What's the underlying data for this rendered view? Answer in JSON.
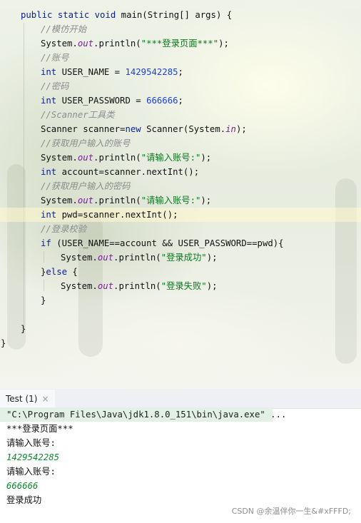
{
  "editor": {
    "signature": {
      "kw1": "public",
      "kw2": "static",
      "kw3": "void",
      "rest": " main(String[] args) {"
    },
    "comment_mock_start": "//模仿开始",
    "print_login_page": {
      "prefix": "System.",
      "field": "out",
      "mid": ".println(",
      "str": "\"***登录页面***\"",
      "suffix": ");"
    },
    "comment_account": "//账号",
    "user_name_decl": {
      "type": "int",
      "name": " USER_NAME = ",
      "value": "1429542285",
      "suffix": ";"
    },
    "comment_password": "//密码",
    "user_password_decl": {
      "type": "int",
      "name": " USER_PASSWORD = ",
      "value": "666666",
      "suffix": ";"
    },
    "comment_scanner": "//Scanner工具类",
    "scanner_decl": {
      "prefix": "Scanner scanner=",
      "kw": "new",
      "mid": " Scanner(System.",
      "field": "in",
      "suffix": ");"
    },
    "comment_get_account": "//获取用户输入的账号",
    "print_prompt_1": {
      "prefix": "System.",
      "field": "out",
      "mid": ".println(",
      "str": "\"请输入账号:\"",
      "suffix": ");"
    },
    "account_decl": {
      "type": "int",
      "rest": " account=scanner.nextInt();"
    },
    "comment_get_password": "//获取用户输入的密码",
    "print_prompt_2": {
      "prefix": "System.",
      "field": "out",
      "mid": ".println(",
      "str": "\"请输入账号:\"",
      "suffix": ");"
    },
    "pwd_decl": {
      "type": "int",
      "rest": " pwd=scanner.nextInt();"
    },
    "comment_login_check": "//登录校验",
    "if_line": {
      "kw": "if",
      "rest": " (USER_NAME==account && USER_PASSWORD==pwd){"
    },
    "print_success": {
      "prefix": "System.",
      "field": "out",
      "mid": ".println(",
      "str": "\"登录成功\"",
      "suffix": ");"
    },
    "else_line": {
      "pre": "}",
      "kw": "else",
      "post": " {"
    },
    "print_fail": {
      "prefix": "System.",
      "field": "out",
      "mid": ".println(",
      "str": "\"登录失败\"",
      "suffix": ");"
    },
    "close_if": "}",
    "close_method": "}",
    "close_class": "}"
  },
  "run_panel": {
    "tab_label": "Test (1)",
    "close_glyph": "×",
    "command": "\"C:\\Program Files\\Java\\jdk1.8.0_151\\bin\\java.exe\" ...",
    "output": {
      "line1": "***登录页面***",
      "line2": "请输入账号:",
      "line3": "1429542285",
      "line4": "请输入账号:",
      "line5": "666666",
      "line6": "登录成功"
    }
  },
  "watermark": "CSDN @余温伴你一生&#xFFFD;",
  "colors": {
    "keyword": "#0a1f8f",
    "number": "#1a3fe0",
    "string": "#087a1c",
    "static_field": "#7a1f9b",
    "comment": "#8c8c8c",
    "console_input": "#0d8a2e",
    "tab_underline": "#3d74d6"
  }
}
